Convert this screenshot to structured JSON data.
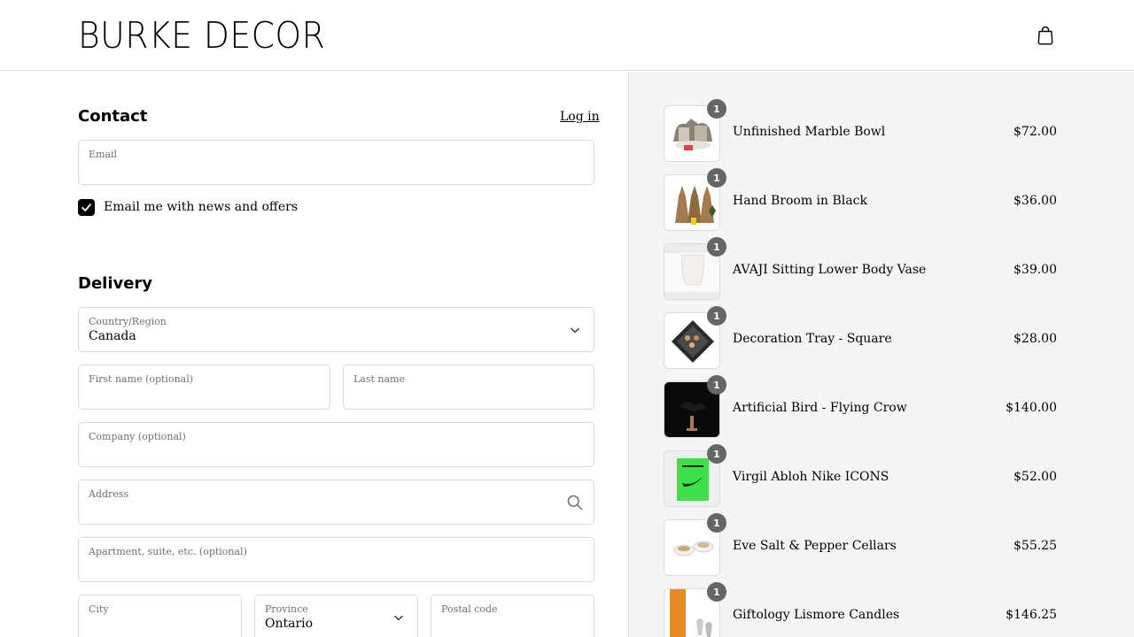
{
  "header": {
    "brand": "BURKE DECOR",
    "cart_icon": "shopping-bag-icon"
  },
  "contact": {
    "title": "Contact",
    "login": "Log in",
    "email_label": "Email",
    "newsletter_label": "Email me with news and offers",
    "newsletter_checked": true
  },
  "delivery": {
    "title": "Delivery",
    "country_label": "Country/Region",
    "country_value": "Canada",
    "first_name_label": "First name (optional)",
    "last_name_label": "Last name",
    "company_label": "Company (optional)",
    "address_label": "Address",
    "apartment_label": "Apartment, suite, etc. (optional)",
    "city_label": "City",
    "province_label": "Province",
    "province_value": "Ontario",
    "postal_label": "Postal code"
  },
  "order": {
    "items": [
      {
        "name": "Unfinished Marble Bowl",
        "price": "$72.00",
        "qty": "1"
      },
      {
        "name": "Hand Broom in Black",
        "price": "$36.00",
        "qty": "1"
      },
      {
        "name": "AVAJI Sitting Lower Body Vase",
        "price": "$39.00",
        "qty": "1"
      },
      {
        "name": "Decoration Tray - Square",
        "price": "$28.00",
        "qty": "1"
      },
      {
        "name": "Artificial Bird - Flying Crow",
        "price": "$140.00",
        "qty": "1"
      },
      {
        "name": "Virgil Abloh Nike ICONS",
        "price": "$52.00",
        "qty": "1"
      },
      {
        "name": "Eve Salt & Pepper Cellars",
        "price": "$55.25",
        "qty": "1"
      },
      {
        "name": "Giftology Lismore Candles",
        "price": "$146.25",
        "qty": "1"
      }
    ]
  },
  "colors": {
    "summary_bg": "#f5f5f5",
    "border": "#d9d9d9",
    "badge": "#666666",
    "checkbox": "#000000"
  }
}
